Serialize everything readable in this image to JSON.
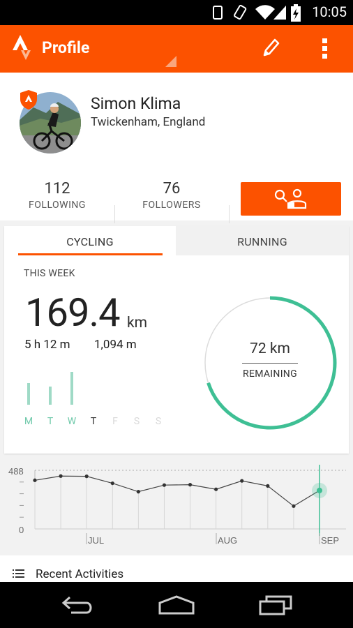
{
  "status_bar": {
    "time": "10:05"
  },
  "app_bar": {
    "title": "Profile"
  },
  "profile": {
    "name": "Simon Klima",
    "location": "Twickenham, England",
    "following_count": "112",
    "following_label": "FOLLOWING",
    "followers_count": "76",
    "followers_label": "FOLLOWERS"
  },
  "tabs": [
    {
      "label": "CYCLING",
      "selected": true
    },
    {
      "label": "RUNNING",
      "selected": false
    }
  ],
  "this_week": {
    "label": "THIS WEEK",
    "distance": "169.4",
    "unit": "km",
    "moving_time": "5 h 12 m",
    "elevation": "1,094 m",
    "remaining_value": "72 km",
    "remaining_label": "REMAINING",
    "goal_progress": 0.7,
    "days": [
      {
        "label": "M",
        "active": true,
        "ride": true,
        "relative_distance": 0.67
      },
      {
        "label": "T",
        "active": true,
        "ride": true,
        "relative_distance": 0.55
      },
      {
        "label": "W",
        "active": true,
        "ride": true,
        "relative_distance": 1.0
      },
      {
        "label": "T",
        "active": false,
        "ride": false,
        "today": true,
        "relative_distance": 0
      },
      {
        "label": "F",
        "active": false,
        "ride": false,
        "relative_distance": 0
      },
      {
        "label": "S",
        "active": false,
        "ride": false,
        "relative_distance": 0
      },
      {
        "label": "S",
        "active": false,
        "ride": false,
        "relative_distance": 0
      }
    ]
  },
  "chart_data": {
    "type": "line",
    "ylim": [
      0,
      488
    ],
    "y_ticks": [
      "488",
      "0"
    ],
    "x_labels": [
      "JUL",
      "AUG",
      "SEP"
    ],
    "values": [
      405,
      440,
      438,
      380,
      310,
      365,
      368,
      330,
      400,
      358,
      190,
      320
    ],
    "highlight_index": 11
  },
  "recent": {
    "label": "Recent Activities"
  },
  "colors": {
    "accent": "#fc5200",
    "goal": "#3ebf94",
    "bar": "#9fdac6"
  }
}
